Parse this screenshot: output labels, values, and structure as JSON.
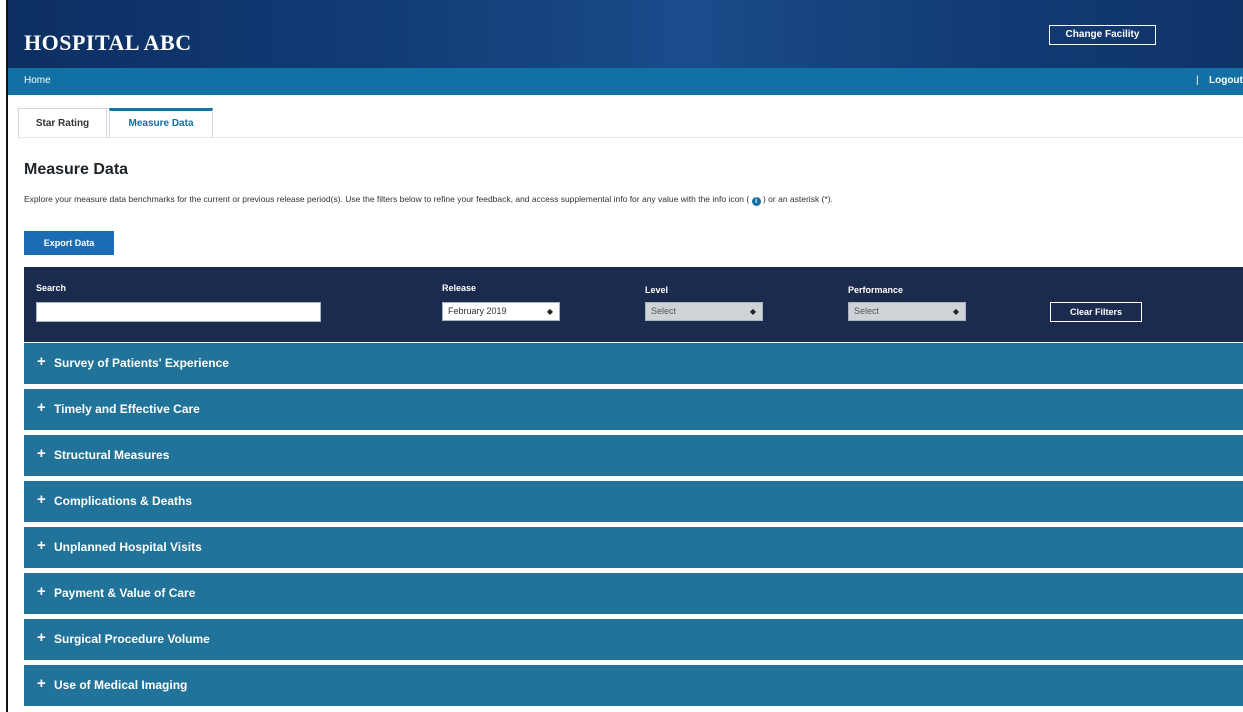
{
  "header": {
    "brand": "HOSPITAL ABC",
    "change_facility_label": "Change Facility"
  },
  "nav": {
    "home": "Home",
    "separator": "|",
    "logout": "Logout"
  },
  "tabs": [
    {
      "label": "Star Rating",
      "active": false
    },
    {
      "label": "Measure Data",
      "active": true
    }
  ],
  "main": {
    "title": "Measure Data",
    "description_before_icon": "Explore your measure data benchmarks for the current or previous release period(s). Use the filters below to refine your feedback, and access supplemental info for any value with the info icon (",
    "info_icon_glyph": "i",
    "description_after_icon": ") or an asterisk (*).",
    "export_label": "Export Data"
  },
  "filters": {
    "search_label": "Search",
    "search_value": "",
    "release_label": "Release",
    "release_value": "February 2019",
    "level_label": "Level",
    "level_value": "Select",
    "performance_label": "Performance",
    "performance_value": "Select",
    "clear_label": "Clear Filters",
    "select_arrow": "◆"
  },
  "accordion": {
    "expand_glyph": "+",
    "items": [
      "Survey of Patients' Experience",
      "Timely and Effective Care",
      "Structural Measures",
      "Complications & Deaths",
      "Unplanned Hospital Visits",
      "Payment & Value of Care",
      "Surgical Procedure Volume",
      "Use of Medical Imaging"
    ]
  },
  "colors": {
    "header": "#123b75",
    "navbar": "#1270a4",
    "filter_bar": "#1a2b4d",
    "accordion": "#217399",
    "accent": "#1270a4"
  }
}
